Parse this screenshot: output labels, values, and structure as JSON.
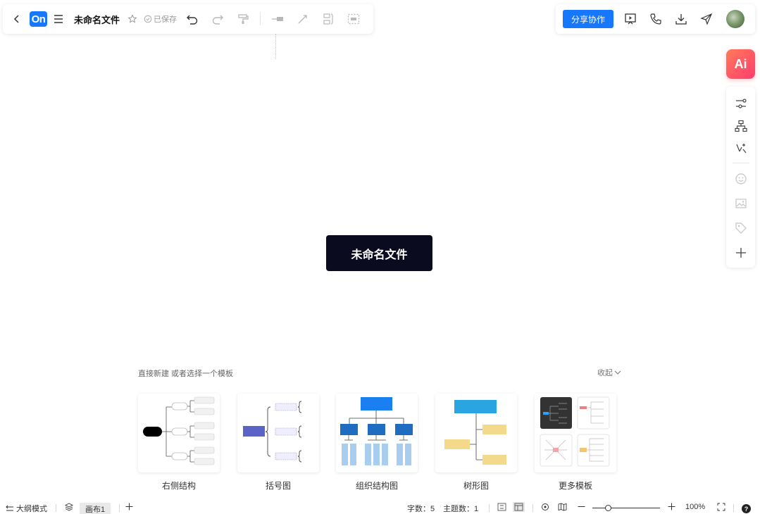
{
  "header": {
    "logo_text": "On",
    "doc_title": "未命名文件",
    "saved_status": "已保存"
  },
  "share": {
    "label": "分享协作"
  },
  "ai": {
    "label": "Ai"
  },
  "canvas": {
    "central_topic": "未命名文件"
  },
  "templates": {
    "hint": "直接新建 或者选择一个模板",
    "collapse_label": "收起",
    "items": [
      {
        "label": "右侧结构"
      },
      {
        "label": "括号图"
      },
      {
        "label": "组织结构图"
      },
      {
        "label": "树形图"
      },
      {
        "label": "更多模板"
      }
    ]
  },
  "footer": {
    "outline_mode": "大纲模式",
    "sheet_tab": "画布1",
    "word_count": "字数：5",
    "topic_count": "主题数：1",
    "zoom": "100%",
    "help": "?"
  },
  "colors": {
    "brand": "#1677ff",
    "central_node": "#0b0b1f",
    "ai_gradient_start": "#ff7a5a",
    "ai_gradient_end": "#ff3d6e"
  }
}
